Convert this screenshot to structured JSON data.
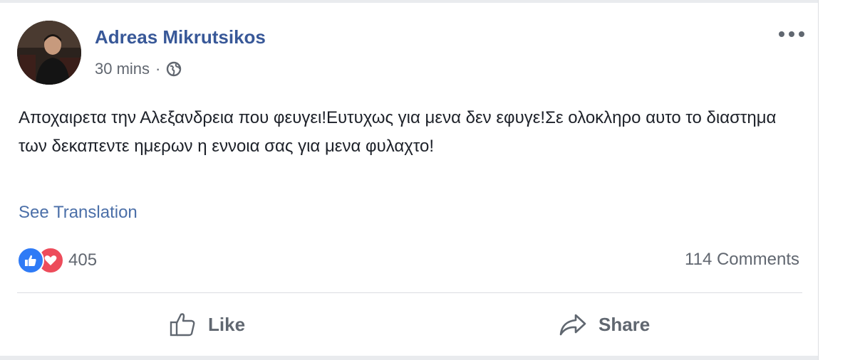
{
  "post": {
    "author": "Adreas Mikrutsikos",
    "time": "30 mins",
    "separator": "·",
    "privacy_icon": "globe-icon",
    "text": "Αποχαιρετα την Αλεξανδρεια που φευγει!Ευτυχως για μενα δεν εφυγε!Σε ολοκληρο αυτο το διαστημα των δεκαπεντε ημερων η εννοια σας για μενα φυλαχτο!",
    "see_translation": "See Translation",
    "reaction_icons": [
      "like-reaction-icon",
      "love-reaction-icon"
    ],
    "reaction_count": "405",
    "comments": "114 Comments",
    "actions": {
      "like": "Like",
      "share": "Share"
    }
  },
  "colors": {
    "author": "#385898",
    "link": "#4b6fa8",
    "like_reaction": "#2f7bf6",
    "love_reaction": "#ed4c5b",
    "secondary_text": "#616770"
  }
}
